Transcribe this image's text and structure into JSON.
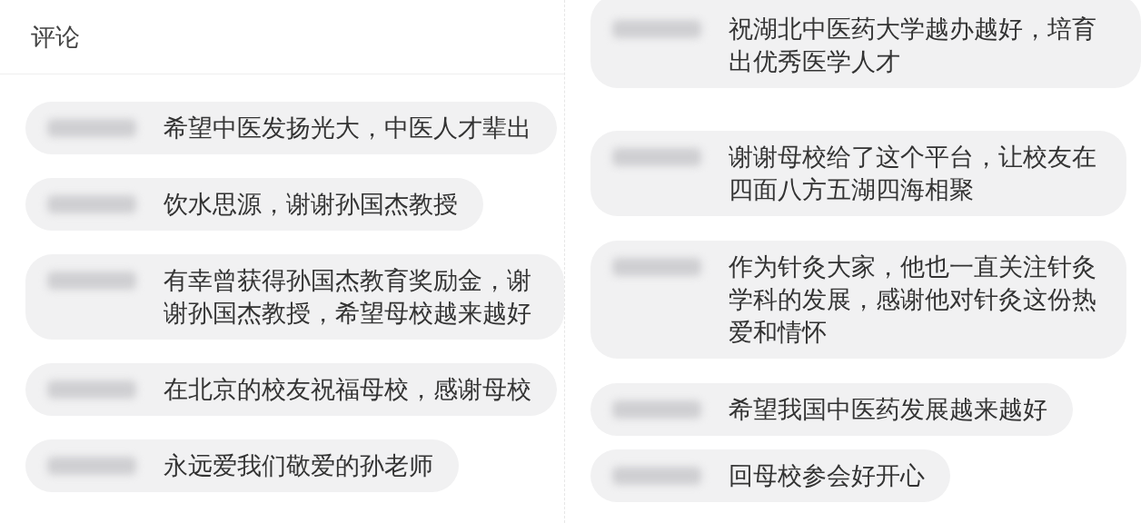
{
  "header": {
    "title": "评论"
  },
  "columns": [
    {
      "comments": [
        {
          "text": "希望中医发扬光大，中医人才辈出"
        },
        {
          "text": "饮水思源，谢谢孙国杰教授"
        },
        {
          "text": "有幸曾获得孙国杰教育奖励金，谢谢孙国杰教授，希望母校越来越好"
        },
        {
          "text": "在北京的校友祝福母校，感谢母校"
        },
        {
          "text": "永远爱我们敬爱的孙老师"
        }
      ]
    },
    {
      "comments": [
        {
          "text": "祝湖北中医药大学越办越好，培育出优秀医学人才"
        },
        {
          "text": "谢谢母校给了这个平台，让校友在四面八方五湖四海相聚"
        },
        {
          "text": "作为针灸大家，他也一直关注针灸学科的发展，感谢他对针灸这份热爱和情怀"
        },
        {
          "text": "希望我国中医药发展越来越好"
        },
        {
          "text": "回母校参会好开心"
        }
      ]
    }
  ]
}
